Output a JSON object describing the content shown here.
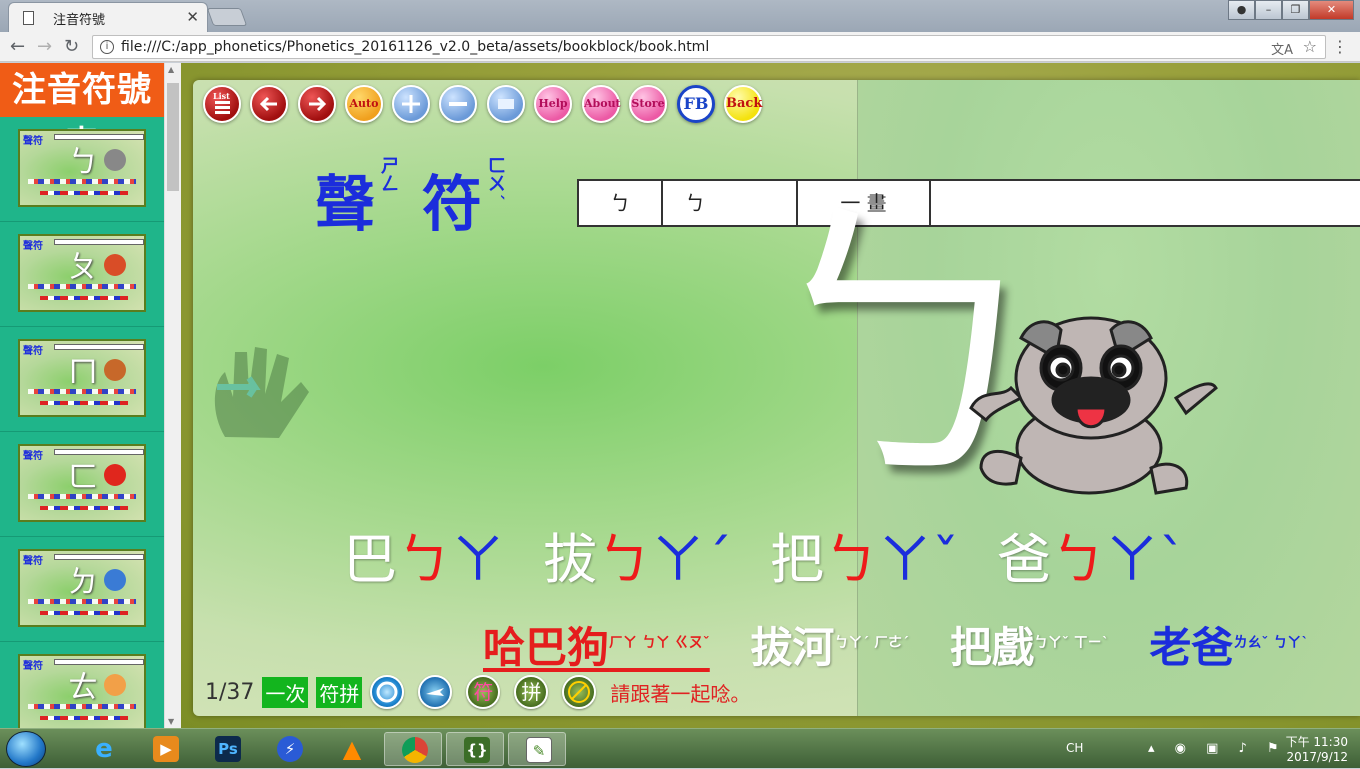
{
  "browser": {
    "tab_title": "注音符號",
    "url": "file:///C:/app_phonetics/Phonetics_20161126_v2.0_beta/assets/bookblock/book.html"
  },
  "sidebar": {
    "title": "注音符號表",
    "thumbs": [
      {
        "head": "聲符",
        "letter": "ㄅ",
        "pic_color": "#888888"
      },
      {
        "head": "聲符",
        "letter": "ㄆ",
        "pic_color": "#d94d27"
      },
      {
        "head": "聲符",
        "letter": "ㄇ",
        "pic_color": "#c7682a"
      },
      {
        "head": "聲符",
        "letter": "ㄈ",
        "pic_color": "#e0261d"
      },
      {
        "head": "聲符",
        "letter": "ㄉ",
        "pic_color": "#3a7bd5"
      },
      {
        "head": "聲符",
        "letter": "ㄊ",
        "pic_color": "#f2a048"
      }
    ]
  },
  "toolbar": {
    "list": "List",
    "auto": "Auto",
    "help": "Help",
    "about": "About",
    "store": "Store",
    "fb": "FB",
    "back": "Back"
  },
  "page": {
    "title_main1": "聲",
    "title_zhuyin1": "ㄕㄥ",
    "title_main2": "符",
    "title_zhuyin2": "ㄈㄨˊ",
    "stroke_cells": [
      "ㄅ",
      "ㄅ",
      "一  畫"
    ],
    "big_letter": "ㄅ",
    "words": [
      {
        "char": "巴",
        "sym": "ㄅ",
        "vowel": "ㄚ",
        "tone": ""
      },
      {
        "char": "拔",
        "sym": "ㄅ",
        "vowel": "ㄚ",
        "tone": "ˊ"
      },
      {
        "char": "把",
        "sym": "ㄅ",
        "vowel": "ㄚ",
        "tone": "ˇ"
      },
      {
        "char": "爸",
        "sym": "ㄅ",
        "vowel": "ㄚ",
        "tone": "ˋ"
      }
    ],
    "phrases": [
      {
        "text": "哈巴狗",
        "zhuyin": "ㄏㄚ ㄅㄚ ㄍㄡˇ"
      },
      {
        "text": "拔河",
        "zhuyin": "ㄅㄚˊ ㄏㄜˊ"
      },
      {
        "text": "把戲",
        "zhuyin": "ㄅㄚˇ ㄒㄧˋ"
      },
      {
        "text": "老爸",
        "zhuyin": "ㄌㄠˇ ㄅㄚˋ"
      }
    ],
    "page_number": "1/37",
    "chip_once": "一次",
    "chip_spell": "符拼",
    "btn_fu": "符",
    "btn_pin": "拼",
    "hint": "請跟著一起唸。"
  },
  "taskbar": {
    "lang": "CH",
    "time": "下午 11:30",
    "date": "2017/9/12"
  }
}
